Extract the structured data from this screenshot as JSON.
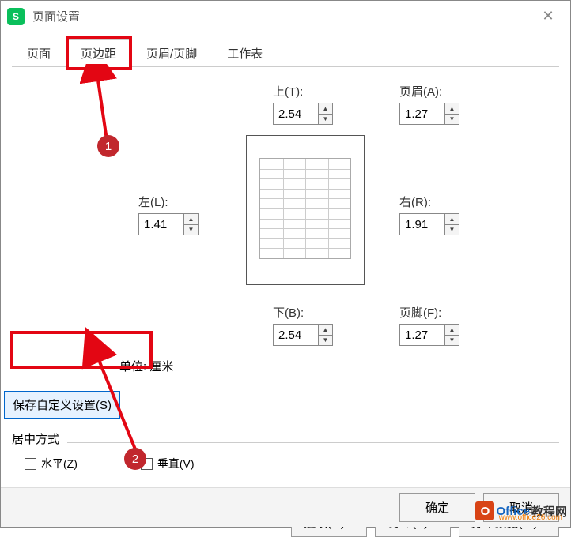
{
  "title": "页面设置",
  "tabs": {
    "page": "页面",
    "margins": "页边距",
    "headerfooter": "页眉/页脚",
    "sheet": "工作表"
  },
  "fields": {
    "top": {
      "label": "上(T):",
      "value": "2.54"
    },
    "header": {
      "label": "页眉(A):",
      "value": "1.27"
    },
    "left": {
      "label": "左(L):",
      "value": "1.41"
    },
    "right": {
      "label": "右(R):",
      "value": "1.91"
    },
    "bottom": {
      "label": "下(B):",
      "value": "2.54"
    },
    "footer": {
      "label": "页脚(F):",
      "value": "1.27"
    }
  },
  "unit_label": "单位: 厘米",
  "save_custom": "保存自定义设置(S)",
  "center_group": "居中方式",
  "checkboxes": {
    "horizontal": "水平(Z)",
    "vertical": "垂直(V)"
  },
  "buttons": {
    "options": "选项(O)...",
    "print": "打印(P)...",
    "preview": "打印预览(W)...",
    "ok": "确定",
    "cancel": "取消"
  },
  "badges": {
    "one": "1",
    "two": "2"
  },
  "watermark": {
    "brand": "Office",
    "suffix": "教程网",
    "url": "www.office26.com"
  }
}
